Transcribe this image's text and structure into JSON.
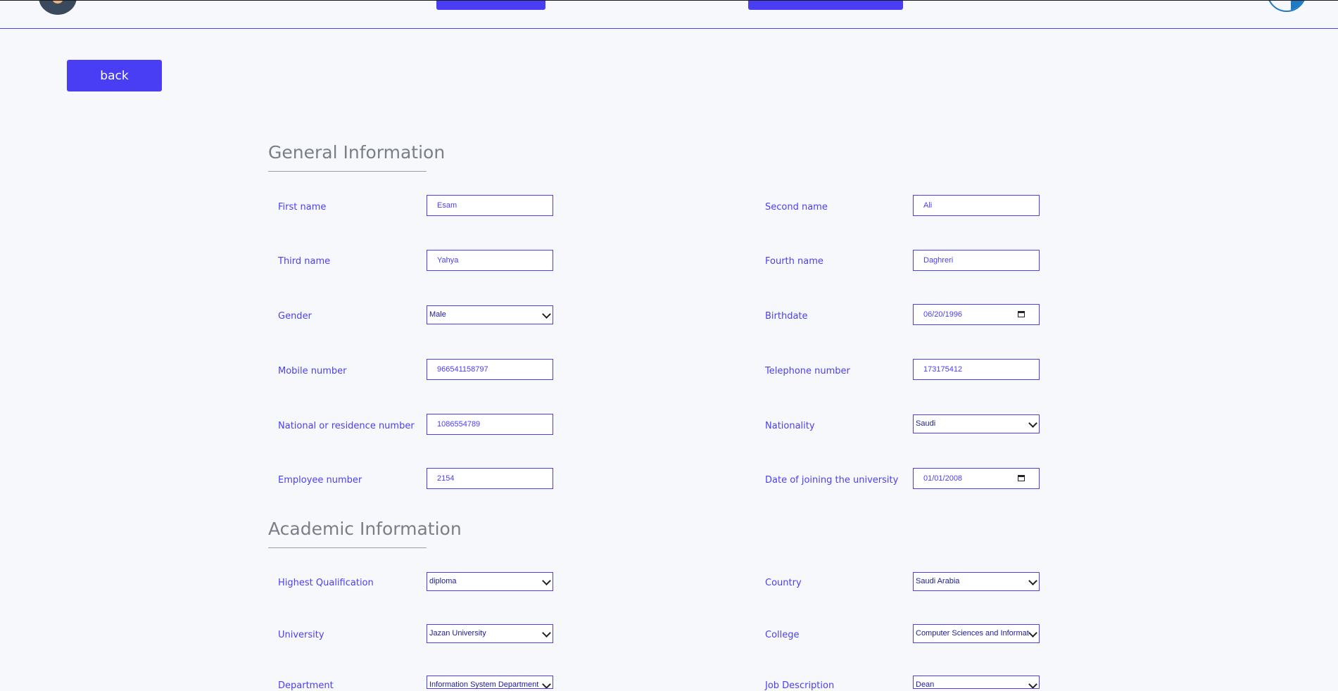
{
  "header": {
    "back_label": "back"
  },
  "general": {
    "title": "General Information",
    "first_name": {
      "label": "First name",
      "value": "Esam"
    },
    "second_name": {
      "label": "Second name",
      "value": "Ali"
    },
    "third_name": {
      "label": "Third name",
      "value": "Yahya"
    },
    "fourth_name": {
      "label": "Fourth name",
      "value": "Daghreri"
    },
    "gender": {
      "label": "Gender",
      "value": "Male"
    },
    "birthdate": {
      "label": "Birthdate",
      "value": "06/20/1996"
    },
    "mobile": {
      "label": "Mobile number",
      "value": "966541158797"
    },
    "telephone": {
      "label": "Telephone number",
      "value": "173175412"
    },
    "national_id": {
      "label": "National or residence number",
      "value": "1086554789"
    },
    "nationality": {
      "label": "Nationality",
      "value": "Saudi"
    },
    "employee_number": {
      "label": "Employee number",
      "value": "2154"
    },
    "join_date": {
      "label": "Date of joining the university",
      "value": "01/01/2008"
    }
  },
  "academic": {
    "title": "Academic Information",
    "qualification": {
      "label": "Highest Qualification",
      "value": "diploma"
    },
    "country": {
      "label": "Country",
      "value": "Saudi Arabia"
    },
    "university": {
      "label": "University",
      "value": "Jazan University"
    },
    "college": {
      "label": "College",
      "value": "Computer Sciences and Informat"
    },
    "department": {
      "label": "Department",
      "value": "Information System Department"
    },
    "job_description": {
      "label": "Job Description",
      "value": "Dean"
    }
  },
  "colors": {
    "accent": "#4a3ef5",
    "background": "#f7f8fb",
    "heading": "#7a7f87"
  }
}
